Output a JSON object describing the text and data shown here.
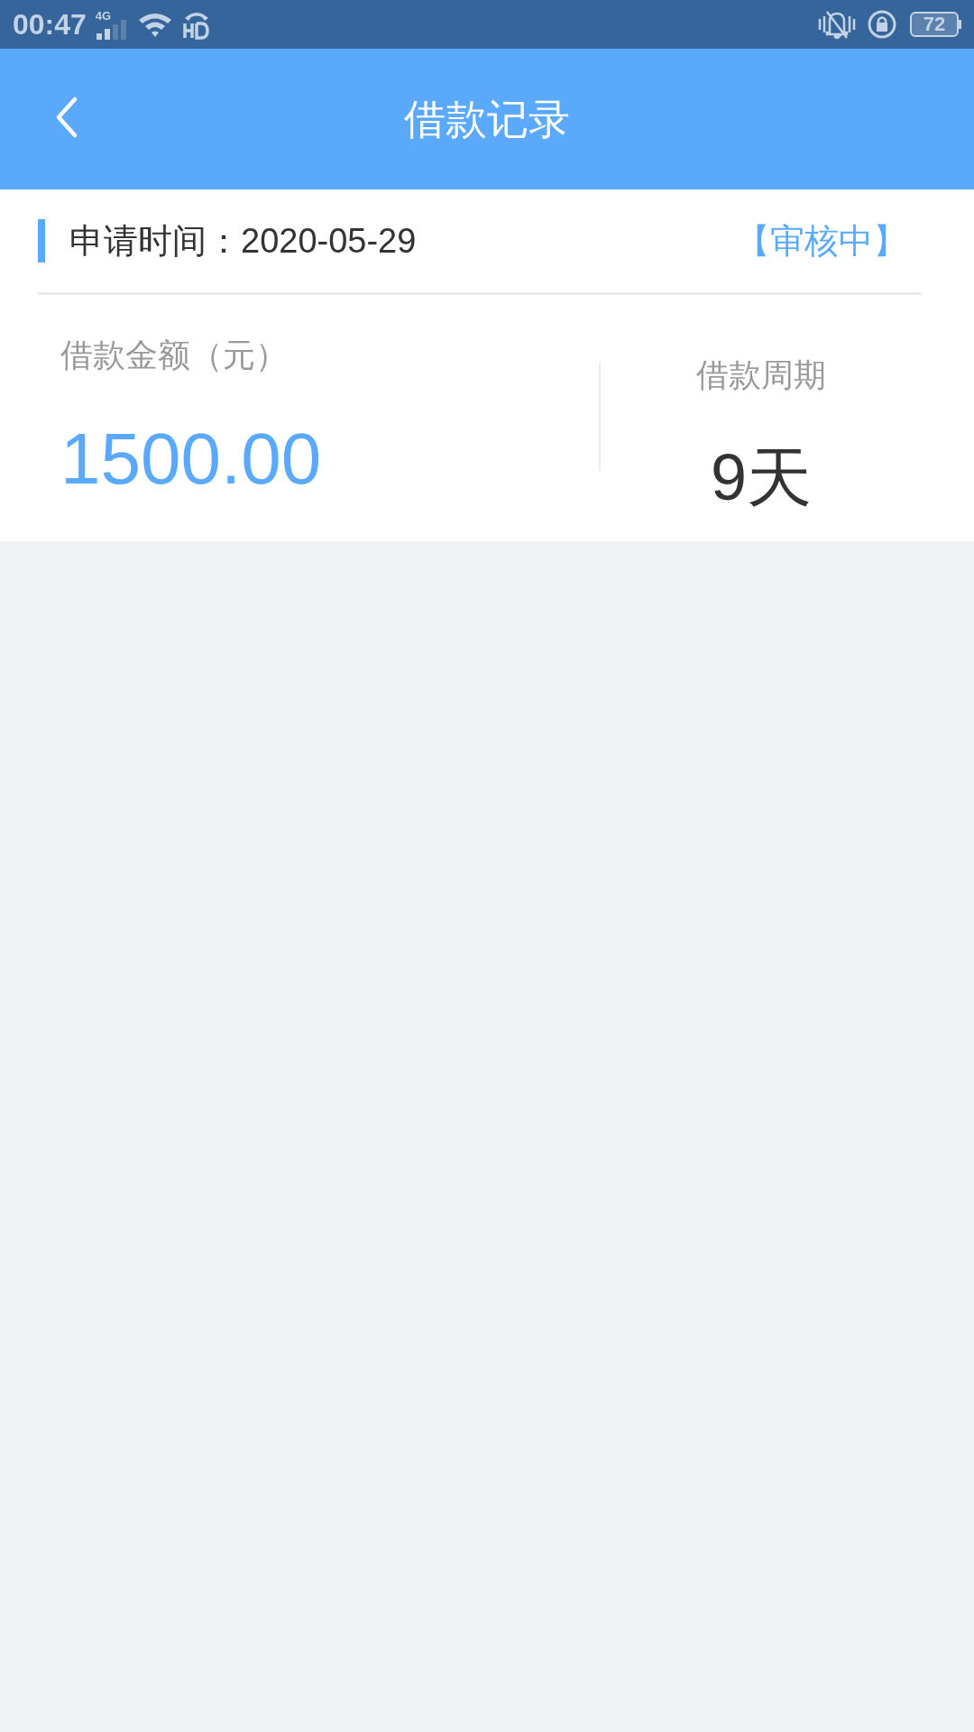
{
  "status_bar": {
    "time": "00:47",
    "network": "4G",
    "battery": "72"
  },
  "header": {
    "title": "借款记录"
  },
  "record": {
    "applied": "申请时间：2020-05-29",
    "status": "【审核中】",
    "amount_label": "借款金额（元）",
    "amount": "1500.00",
    "period_label": "借款周期",
    "period": "9天"
  }
}
